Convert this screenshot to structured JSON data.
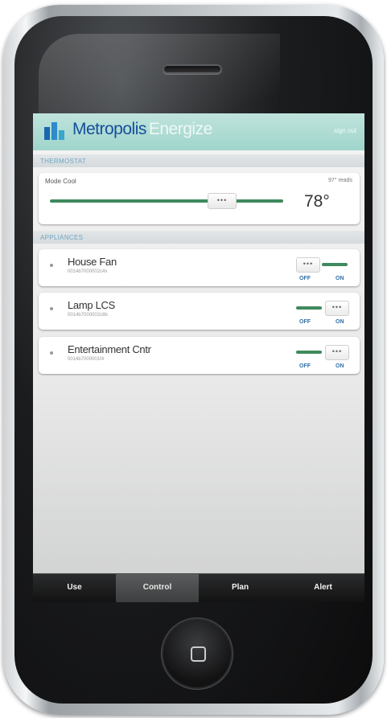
{
  "header": {
    "brand_primary": "Metropolis",
    "brand_secondary": "Energize",
    "sign_out": "sign out"
  },
  "thermostat": {
    "section_label": "THERMOSTAT",
    "mode": "Mode Cool",
    "mode_right": "97° reads",
    "handle_glyph": "•••",
    "temperature": "78°"
  },
  "appliances": {
    "section_label": "APPLIANCES",
    "items": [
      {
        "name": "House Fan",
        "id": "0014b7000002c4x",
        "state": "on",
        "handle_glyph": "•••",
        "off_label": "OFF",
        "on_label": "ON"
      },
      {
        "name": "Lamp LCS",
        "id": "0014b7000002c8b",
        "state": "off",
        "handle_glyph": "•••",
        "off_label": "OFF",
        "on_label": "ON"
      },
      {
        "name": "Entertainment Cntr",
        "id": "0014b7000001f4",
        "state": "off",
        "handle_glyph": "•••",
        "off_label": "OFF",
        "on_label": "ON"
      }
    ]
  },
  "tabs": [
    {
      "label": "Use",
      "active": false
    },
    {
      "label": "Control",
      "active": true
    },
    {
      "label": "Plan",
      "active": false
    },
    {
      "label": "Alert",
      "active": false
    }
  ],
  "colors": {
    "header_bg": "#a9d9cf",
    "brand_blue": "#154e9c",
    "slider_green": "#3f8a5d",
    "toggle_label_blue": "#2f6fa8",
    "section_label_blue": "#6ea6c3"
  },
  "icons": {
    "logo": "metropolis-bars-logo",
    "home_button": "home-square-icon"
  }
}
